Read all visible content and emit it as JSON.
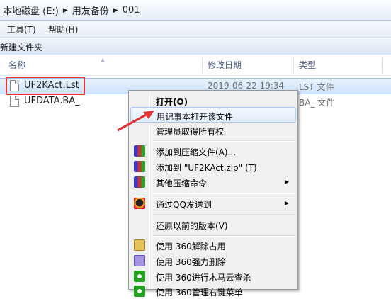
{
  "address": {
    "crumbs": [
      "本地磁盘 (E:)",
      "用友备份",
      "001"
    ]
  },
  "menu": {
    "tools": "工具(T)",
    "help": "帮助(H)"
  },
  "command_bar": {
    "new_folder": "新建文件夹"
  },
  "columns": {
    "name": "名称",
    "modified": "修改日期",
    "type": "类型"
  },
  "files": [
    {
      "name": "UF2KAct.Lst",
      "modified": "2019-06-22 19:34",
      "type": "LST 文件"
    },
    {
      "name": "UFDATA.BA_",
      "modified": "",
      "type": "BA_ 文件"
    }
  ],
  "context_menu": {
    "open": "打开(O)",
    "open_with_notepad": "用记事本打开该文件",
    "take_ownership": "管理员取得所有权",
    "add_to_archive": "添加到压缩文件(A)...",
    "add_to_zip": "添加到 \"UF2KAct.zip\" (T)",
    "other_compress": "其他压缩命令",
    "send_via_qq": "通过QQ发送到",
    "restore_previous": "还原以前的版本(V)",
    "unlock_360": "使用 360解除占用",
    "force_delete_360": "使用 360强力删除",
    "trojan_scan_360": "使用 360进行木马云查杀",
    "manage_menu_360": "使用 360管理右键菜单"
  },
  "colors": {
    "highlight_box": "#e33333",
    "annotation_arrow": "#e33333",
    "selection": "#cfe3fb"
  }
}
